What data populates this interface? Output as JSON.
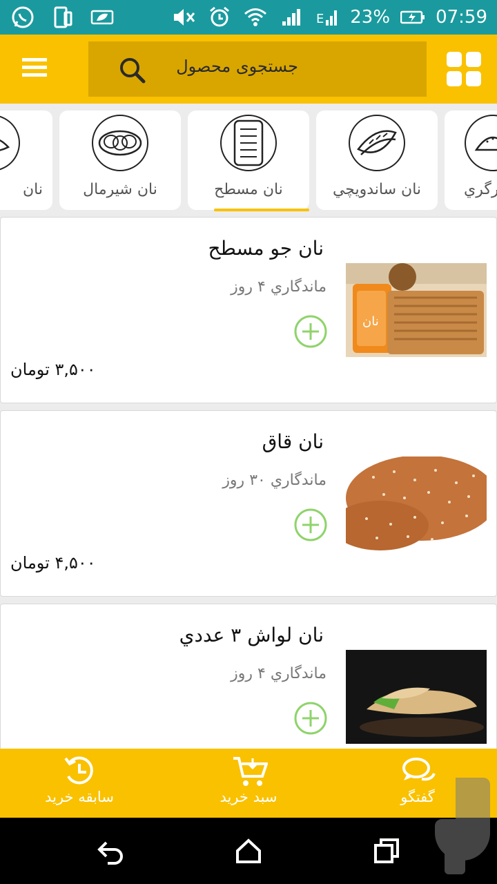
{
  "status_bar": {
    "battery": "23%",
    "time": "07:59",
    "left_icons": [
      "whatsapp-icon",
      "phone-device-icon",
      "leaf-battery-icon"
    ],
    "right_icons": [
      "mute-icon",
      "alarm-icon",
      "wifi-icon",
      "signal-icon",
      "signal-e-icon",
      "battery-icon"
    ]
  },
  "toolbar": {
    "search_placeholder": "جستجوی محصول",
    "colors": {
      "bar": "#f9c100",
      "search_bg": "#d9a600"
    }
  },
  "categories": [
    {
      "label": "نان",
      "icon": "bread-roll-icon",
      "active": false
    },
    {
      "label": "نان شيرمال",
      "icon": "braided-bread-icon",
      "active": false
    },
    {
      "label": "نان مسطح",
      "icon": "flat-bread-icon",
      "active": true
    },
    {
      "label": "نان ساندويچي",
      "icon": "baguette-icon",
      "active": false
    },
    {
      "label": "برگري",
      "icon": "burger-bun-icon",
      "active": false
    }
  ],
  "products": [
    {
      "title": "نان جو مسطح",
      "shelf_life": "ماندگاري ۴ روز",
      "price": "۳,۵۰۰ تومان",
      "image": "barley-flatbread-photo"
    },
    {
      "title": "نان قاق",
      "shelf_life": "ماندگاري ۳۰ روز",
      "price": "۴,۵۰۰ تومان",
      "image": "dry-bread-photo"
    },
    {
      "title": "نان لواش ۳ عددي",
      "shelf_life": "ماندگاري ۴ روز",
      "price": "",
      "image": "lavash-wrap-photo"
    }
  ],
  "bottom_nav": {
    "history_label": "سابقه خريد",
    "cart_label": "سبد خريد",
    "chat_label": "گفتگو"
  }
}
